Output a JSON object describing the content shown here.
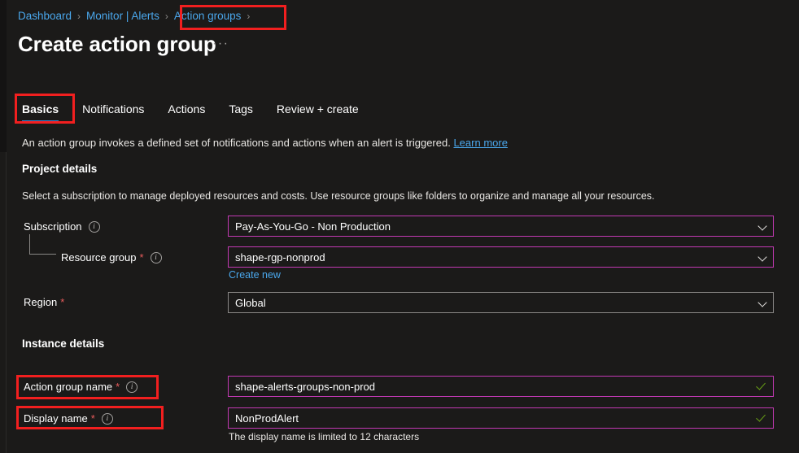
{
  "breadcrumb": {
    "items": [
      {
        "label": "Dashboard",
        "highlighted": false
      },
      {
        "label": "Monitor | Alerts",
        "highlighted": false
      },
      {
        "label": "Action groups",
        "highlighted": true
      }
    ],
    "separator": "›"
  },
  "header": {
    "title": "Create action group",
    "overflow_menu": "···"
  },
  "tabs": [
    {
      "label": "Basics",
      "active": true
    },
    {
      "label": "Notifications",
      "active": false
    },
    {
      "label": "Actions",
      "active": false
    },
    {
      "label": "Tags",
      "active": false
    },
    {
      "label": "Review + create",
      "active": false
    }
  ],
  "main": {
    "intro_text": "An action group invokes a defined set of notifications and actions when an alert is triggered.",
    "intro_link": "Learn more",
    "project_details": {
      "heading": "Project details",
      "description": "Select a subscription to manage deployed resources and costs. Use resource groups like folders to organize and manage all your resources.",
      "subscription": {
        "label": "Subscription",
        "value": "Pay-As-You-Go - Non Production",
        "required": false,
        "info_icon": "info-icon",
        "chevron_icon": "chevron-down-icon"
      },
      "resource_group": {
        "label": "Resource group",
        "required_marker": "*",
        "value": "shape-rgp-nonprod",
        "info_icon": "info-icon",
        "chevron_icon": "chevron-down-icon",
        "create_new_link": "Create new"
      },
      "region": {
        "label": "Region",
        "required_marker": "*",
        "value": "Global",
        "chevron_icon": "chevron-down-icon"
      }
    },
    "instance_details": {
      "heading": "Instance details",
      "action_group_name": {
        "label": "Action group name",
        "required_marker": "*",
        "value": "shape-alerts-groups-non-prod",
        "info_icon": "info-icon",
        "valid_icon": "checkmark-icon"
      },
      "display_name": {
        "label": "Display name",
        "required_marker": "*",
        "value": "NonProdAlert",
        "info_icon": "info-icon",
        "valid_icon": "checkmark-icon",
        "hint": "The display name is limited to 12 characters"
      }
    }
  },
  "colors": {
    "background": "#1b1a19",
    "link": "#4aa7ec",
    "tab_accent": "#2b88d8",
    "focus_border": "#c239b3",
    "default_border": "#8a8886",
    "required_asterisk": "#e85c5c",
    "valid_check": "#6aa116",
    "annotation_outline": "#f21f1f"
  }
}
